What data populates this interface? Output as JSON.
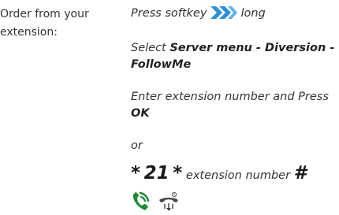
{
  "left_label": {
    "line1": "Order from your",
    "line2": "extension:"
  },
  "steps": {
    "step1_prefix": "Press softkey",
    "step1_suffix": "long",
    "step2_prefix": "Select ",
    "step2_bold_line1": "Server menu - Diversion -",
    "step2_bold_line2": "FollowMe",
    "step3_line1": "Enter extension number and Press",
    "step3_bold": "OK",
    "or_text": "or",
    "code_star1": "*",
    "code_number": "21",
    "code_star2": "*",
    "code_text": "extension number",
    "code_hash": "#"
  },
  "icons": {
    "softkey": "double-chevron-right-icon",
    "pickup": "phone-handset-icon",
    "hangup": "hang-up-icon"
  },
  "colors": {
    "softkey_blue": "#2a8fd6",
    "phone_green": "#1e8a3a",
    "text": "#333333"
  }
}
